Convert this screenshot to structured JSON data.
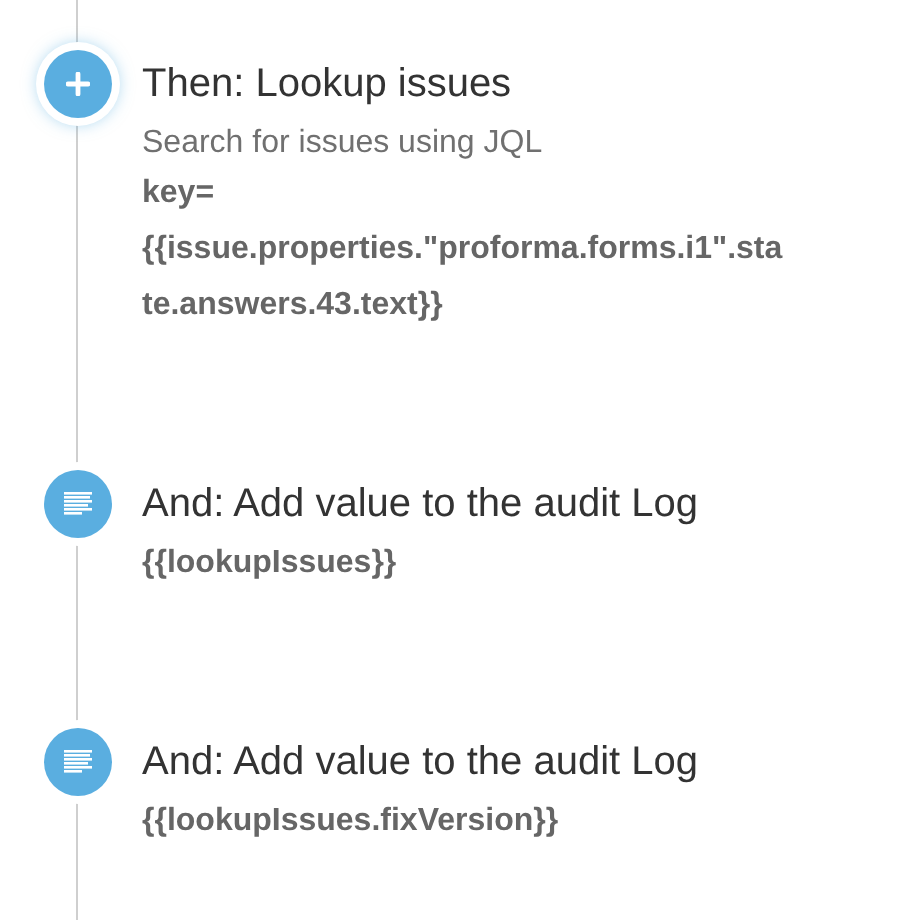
{
  "steps": [
    {
      "kind": "lookup",
      "selected": true,
      "title": "Then: Lookup issues",
      "subtitle": "Search for issues using JQL",
      "detail": "key= {{issue.properties.\"proforma.forms.i1\".state.answers.43.text}}"
    },
    {
      "kind": "log",
      "selected": false,
      "title": "And: Add value to the audit Log",
      "detail": "{{lookupIssues}}"
    },
    {
      "kind": "log",
      "selected": false,
      "title": "And: Add value to the audit Log",
      "detail": "{{lookupIssues.fixVersion}}"
    }
  ]
}
